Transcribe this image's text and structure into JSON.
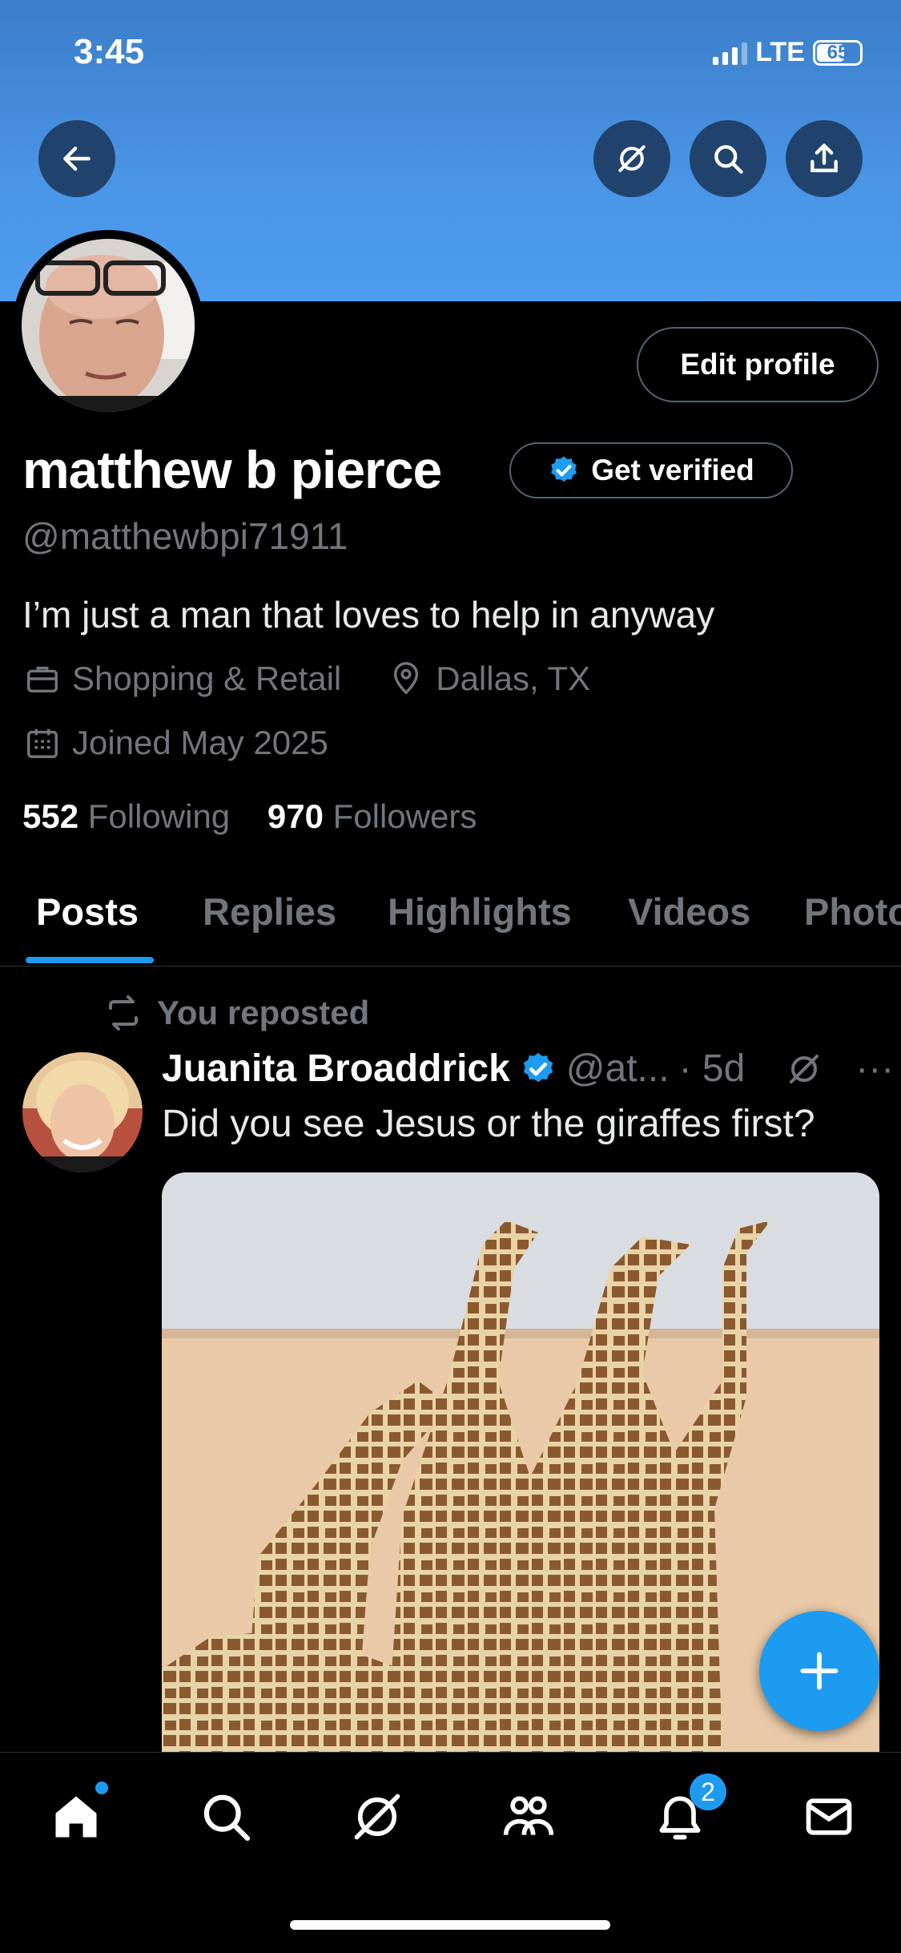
{
  "status": {
    "time": "3:45",
    "network": "LTE",
    "battery": "65",
    "battery_fraction": 0.65
  },
  "topbar": {
    "back_icon": "arrow-left-icon",
    "grok_icon": "grok-icon",
    "search_icon": "search-icon",
    "share_icon": "share-icon"
  },
  "profile": {
    "edit_label": "Edit profile",
    "name": "matthew b pierce",
    "get_verified_label": "Get verified",
    "handle": "@matthewbpi71911",
    "bio": "I’m just a man that loves to help in anyway",
    "category": "Shopping & Retail",
    "location": "Dallas, TX",
    "joined": "Joined May 2025",
    "following_count": "552",
    "following_label": "Following",
    "followers_count": "970",
    "followers_label": "Followers"
  },
  "tabs": [
    "Posts",
    "Replies",
    "Highlights",
    "Videos",
    "Photos"
  ],
  "post": {
    "repost_label": "You reposted",
    "author": "Juanita Broaddrick",
    "handle": "@at...",
    "time": "· 5d",
    "more": "···",
    "text": "Did you see Jesus or the giraffes first?"
  },
  "nav": {
    "notifications_badge": "2"
  },
  "colors": {
    "accent": "#1d9bf0",
    "banner": "#4c9cef",
    "background": "#000000"
  }
}
